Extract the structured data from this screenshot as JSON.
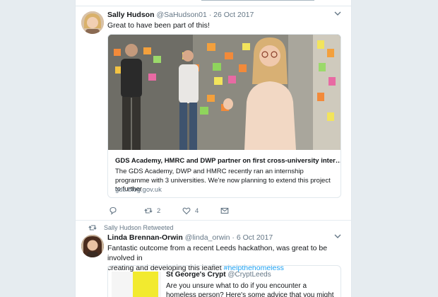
{
  "tweets": [
    {
      "name": "Sally Hudson",
      "handle": "@SaHudson01",
      "date": "26 Oct 2017",
      "text": "Great to have been part of this!",
      "card": {
        "title": "GDS Academy, HMRC and DWP partner on first cross-university inter…",
        "description": "The GDS Academy, DWP and HMRC recently ran an internship programme with 3 universities. We're now planning to extend this project to further",
        "domain": "gds.blog.gov.uk"
      },
      "actions": {
        "reply_icon": "reply-icon",
        "retweet_count": "2",
        "like_count": "4",
        "message_icon": "message-icon"
      }
    },
    {
      "retweet_context": "Sally Hudson Retweeted",
      "name": "Linda Brennan-Orwin",
      "handle": "@linda_orwin",
      "date": "6 Oct 2017",
      "text_line1": "Fantastic outcome from a recent Leeds hackathon, was great to be involved in",
      "text_line2": "creating and developing this leaflet ",
      "hashtag": "#helpthehomeless",
      "quote": {
        "name": "St George's Crypt",
        "handle": "@CryptLeeds",
        "text": "Are you unsure what to do if you encounter a homeless person? Here's some advice that you might find useful..."
      }
    }
  ],
  "colors": {
    "accent": "#1da1f2",
    "secondary": "#657786",
    "background": "#e6ecf0"
  }
}
